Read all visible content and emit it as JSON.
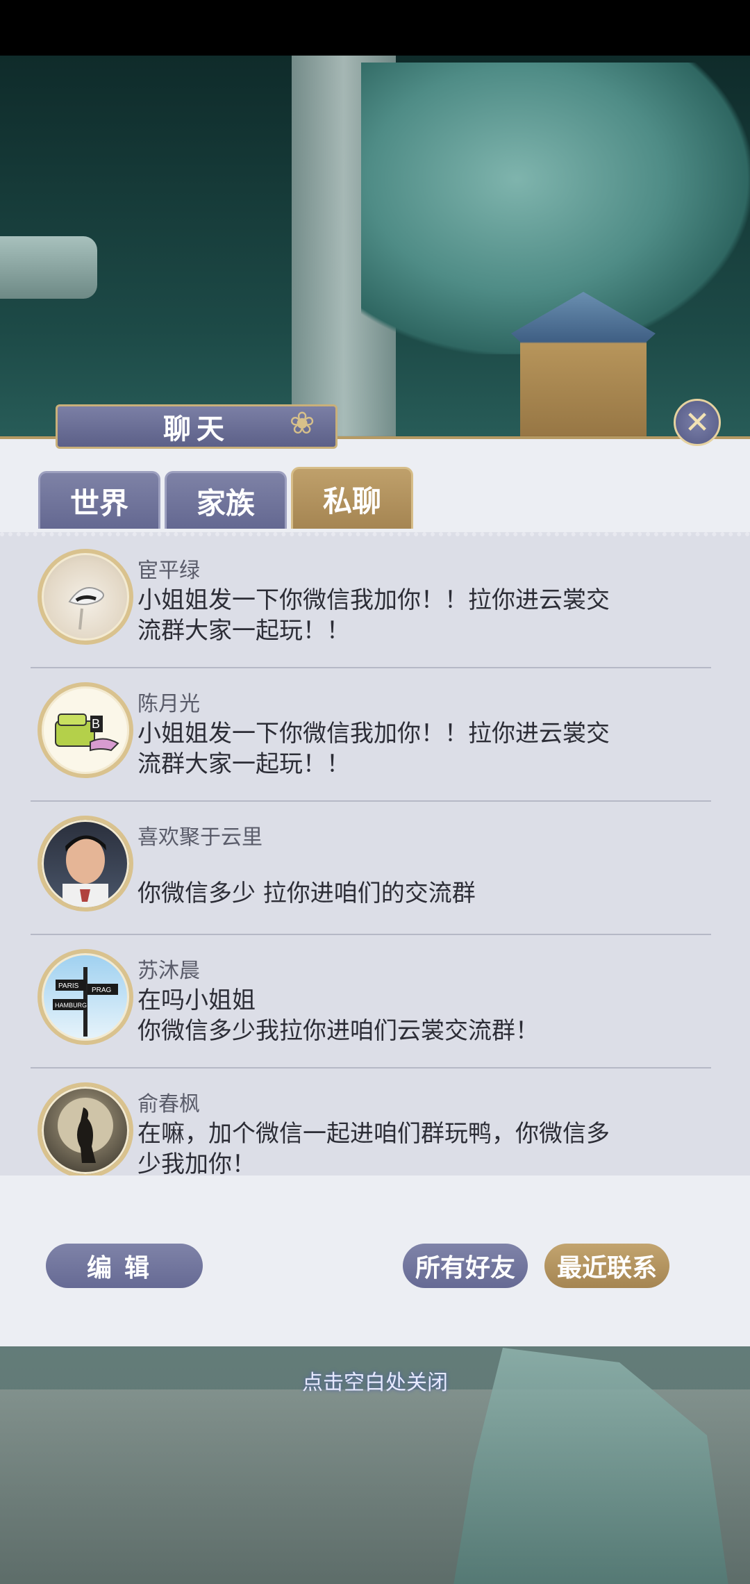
{
  "title": "聊天",
  "tabs": [
    {
      "label": "世界",
      "active": false
    },
    {
      "label": "家族",
      "active": false
    },
    {
      "label": "私聊",
      "active": true
    }
  ],
  "messages": [
    {
      "name": "宦平绿",
      "text": "小姐姐发一下你微信我加你！！拉你进云裳交流群大家一起玩！！",
      "avatar_desc": "hat-icon"
    },
    {
      "name": "陈月光",
      "text": "小姐姐发一下你微信我加你！！拉你进云裳交流群大家一起玩！！",
      "avatar_desc": "sofa-icon"
    },
    {
      "name": "喜欢聚于云里",
      "text": "你微信多少  拉你进咱们的交流群",
      "avatar_desc": "portrait-icon"
    },
    {
      "name": "苏沐晨",
      "text": "在吗小姐姐\n你微信多少我拉你进咱们云裳交流群！",
      "avatar_desc": "signpost-icon"
    },
    {
      "name": "俞春枫",
      "text": "在嘛，加个微信一起进咱们群玩鸭，你微信多少我加你！",
      "avatar_desc": "moon-figure-icon"
    }
  ],
  "buttons": {
    "edit": "编辑",
    "all_friends": "所有好友",
    "recent": "最近联系"
  },
  "close_hint": "点击空白处关闭",
  "colors": {
    "accent_gold": "#a58552",
    "accent_purple": "#666a94"
  }
}
